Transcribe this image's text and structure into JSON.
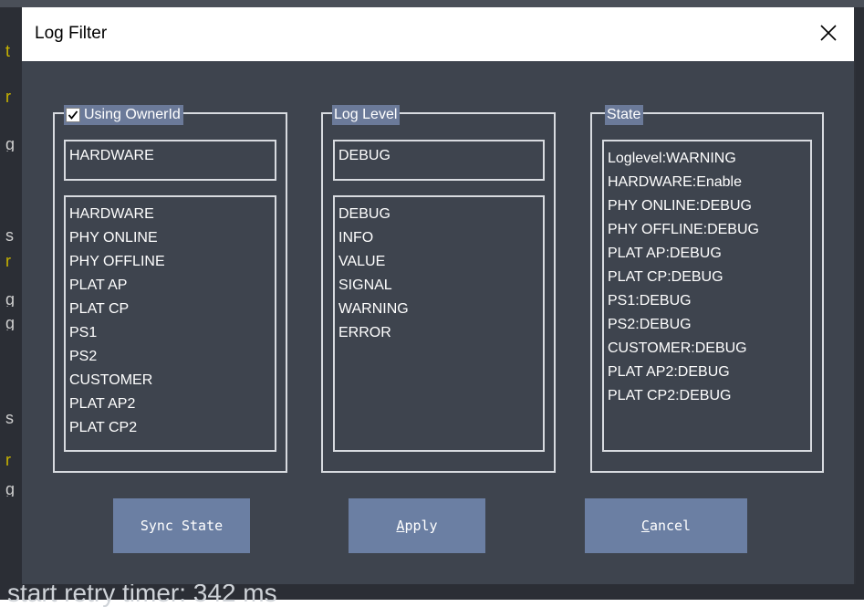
{
  "background": {
    "bottom_text": "start retry timer: 342 ms"
  },
  "dialog": {
    "title": "Log Filter",
    "close_glyph": "×"
  },
  "owner_group": {
    "label": "Using OwnerId",
    "checked": true,
    "selected_value": "HARDWARE",
    "items": [
      "HARDWARE",
      "PHY ONLINE",
      "PHY OFFLINE",
      "PLAT AP",
      "PLAT CP",
      "PS1",
      "PS2",
      "CUSTOMER",
      "PLAT AP2",
      "PLAT CP2"
    ]
  },
  "level_group": {
    "label": "Log Level",
    "selected_value": "DEBUG",
    "items": [
      "DEBUG",
      "INFO",
      "VALUE",
      "SIGNAL",
      "WARNING",
      "ERROR"
    ]
  },
  "state_group": {
    "label": "State",
    "items": [
      "Loglevel:WARNING",
      "HARDWARE:Enable",
      "PHY ONLINE:DEBUG",
      "PHY OFFLINE:DEBUG",
      "PLAT AP:DEBUG",
      "PLAT CP:DEBUG",
      "PS1:DEBUG",
      "PS2:DEBUG",
      "CUSTOMER:DEBUG",
      "PLAT AP2:DEBUG",
      "PLAT CP2:DEBUG"
    ]
  },
  "buttons": {
    "sync": "Sync State",
    "apply_accel": "A",
    "apply_rest": "pply",
    "cancel_accel": "C",
    "cancel_rest": "ancel"
  },
  "colors": {
    "dialog_bg": "#3e444e",
    "accent": "#6b7fa3",
    "border": "#d8dbe0"
  }
}
